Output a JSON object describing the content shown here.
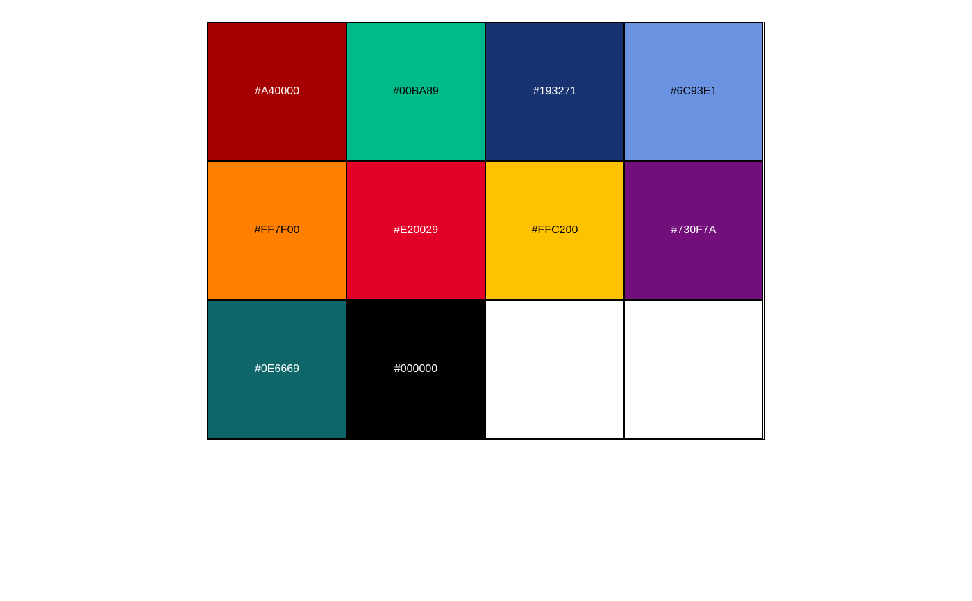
{
  "palette": {
    "swatches": [
      {
        "label": "#A40000",
        "color": "#A40000",
        "text_color": "#ffffff"
      },
      {
        "label": "#00BA89",
        "color": "#00BA89",
        "text_color": "#000000"
      },
      {
        "label": "#193271",
        "color": "#193271",
        "text_color": "#ffffff"
      },
      {
        "label": "#6C93E1",
        "color": "#6C93E1",
        "text_color": "#000000"
      },
      {
        "label": "#FF7F00",
        "color": "#FF7F00",
        "text_color": "#000000"
      },
      {
        "label": "#E20029",
        "color": "#E20029",
        "text_color": "#ffffff"
      },
      {
        "label": "#FFC200",
        "color": "#FFC200",
        "text_color": "#000000"
      },
      {
        "label": "#730F7A",
        "color": "#730F7A",
        "text_color": "#ffffff"
      },
      {
        "label": "#0E6669",
        "color": "#0E6669",
        "text_color": "#ffffff"
      },
      {
        "label": "#000000",
        "color": "#000000",
        "text_color": "#ffffff"
      },
      {
        "label": "",
        "color": "#ffffff",
        "text_color": "#000000"
      },
      {
        "label": "",
        "color": "#ffffff",
        "text_color": "#000000"
      }
    ]
  }
}
